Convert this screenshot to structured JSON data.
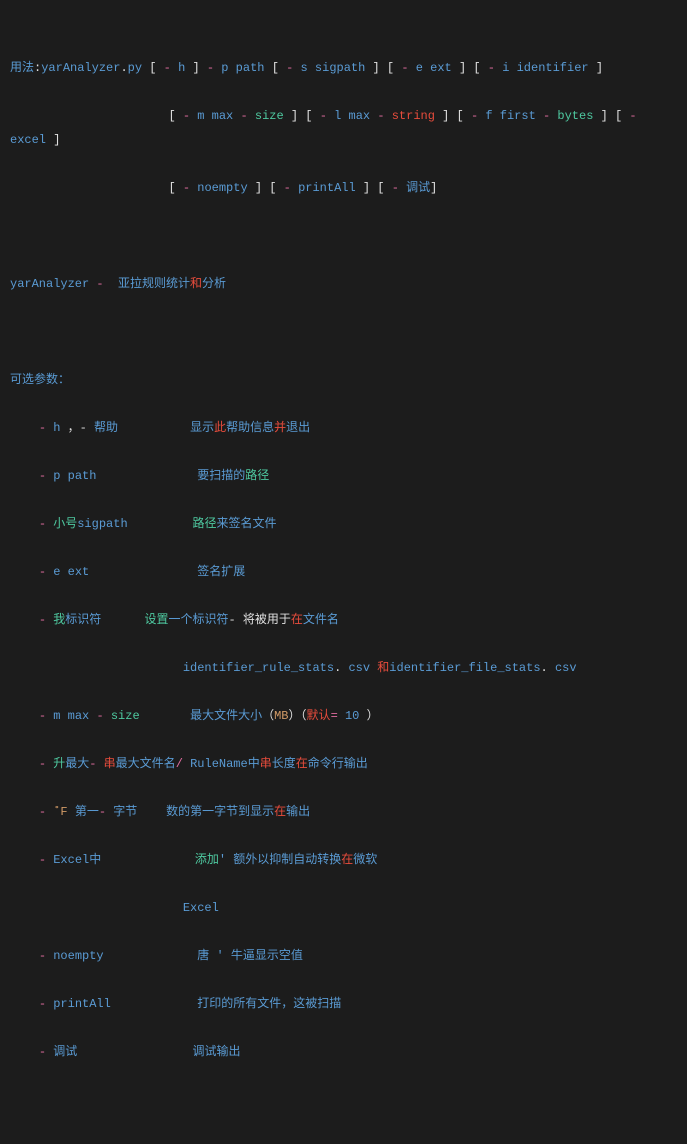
{
  "usage_line1": {
    "t1": "用法",
    "t2": ":",
    "t3": "yarAnalyzer",
    "t4": ".",
    "t5": "py ",
    "t6": "[",
    "t7": " - ",
    "t8": "h ",
    "t9": "]",
    "t10": " - ",
    "t11": "p path ",
    "t12": "[",
    "t13": " - ",
    "t14": "s sigpath ",
    "t15": "]",
    "t16": " [",
    "t17": " - ",
    "t18": "e ext ",
    "t19": "]",
    "t20": " [",
    "t21": " - ",
    "t22": "i identifier ",
    "t23": "]"
  },
  "usage_line2": {
    "t1": "[",
    "t2": " - ",
    "t3": "m max ",
    "t4": "- ",
    "t5": "size ",
    "t6": "]",
    "t7": " [",
    "t8": " - ",
    "t9": "l max ",
    "t10": "- ",
    "t11": "string ",
    "t12": "]",
    "t13": " [",
    "t14": " - ",
    "t15": "f first ",
    "t16": "- ",
    "t17": "bytes ",
    "t18": "]",
    "t19": " [",
    "t20": " - ",
    "t21": "excel ",
    "t22": "]"
  },
  "usage_line3": {
    "t1": "[",
    "t2": " - ",
    "t3": "noempty ",
    "t4": "]",
    "t5": " [",
    "t6": " - ",
    "t7": "printAll ",
    "t8": "]",
    "t9": " [",
    "t10": " - ",
    "t11": "调试",
    "t12": "]"
  },
  "desc": {
    "t1": "yarAnalyzer",
    "t2": " - ",
    "t3": " 亚拉规则统计",
    "t4": "和",
    "t5": "分析"
  },
  "opts_label": "可选参数：",
  "h": {
    "t1": "- ",
    "t2": "h ",
    "t3": "，- ",
    "t4": "帮助",
    "t5": "显示",
    "t6": "此",
    "t7": "帮助信息",
    "t8": "并",
    "t9": "退出"
  },
  "p": {
    "t1": "- ",
    "t2": "p path",
    "t3": "要扫描的",
    "t4": "路径"
  },
  "s": {
    "t1": "- ",
    "t2": "小号",
    "t3": "sigpath",
    "t4": "路径",
    "t5": "来",
    "t6": "签名文件"
  },
  "e": {
    "t1": "- ",
    "t2": "e ext",
    "t3": "签名扩展"
  },
  "i": {
    "t1": "- ",
    "t2": "我",
    "t3": "标识符",
    "t4": "设置",
    "t5": "一个标识符",
    "t6": "- 将被用于",
    "t7": "在",
    "t8": "文件名",
    "sub1": "identifier_rule_stats",
    "sub2": ". ",
    "sub3": "csv ",
    "sub4": "和",
    "sub5": "identifier_file_stats",
    "sub6": ". ",
    "sub7": "csv"
  },
  "m": {
    "t1": "- ",
    "t2": "m max ",
    "t3": "- ",
    "t4": "size",
    "t5": "最大文件大小",
    "t6": "（",
    "t7": "MB",
    "t8": "）",
    "t9": "（",
    "t10": "默认",
    "t11": "= ",
    "t12": "10 ",
    "t13": "）"
  },
  "l": {
    "t1": "- ",
    "t2": "升",
    "t3": "最大",
    "t4": "- ",
    "t5": "串",
    "t6": "最大文件名",
    "t7": "/ ",
    "t8": "RuleName",
    "t9": "中",
    "t10": "串",
    "t11": "长度",
    "t12": "在",
    "t13": "命令行输出"
  },
  "f": {
    "t1": "- ",
    "t2": "˚F ",
    "t3": "第一",
    "t4": "- ",
    "t5": "字节",
    "t6": "数的第一字节到显示",
    "t7": "在",
    "t8": "输出"
  },
  "x": {
    "t1": "- ",
    "t2": "Excel中",
    "t3": "添加",
    "t4": "' 额外以抑制自动转换",
    "t5": "在",
    "t6": "微软",
    "sub1": "Excel"
  },
  "n": {
    "t1": "- ",
    "t2": "noempty",
    "t3": "唐 ",
    "t4": "' 牛逼显示空值"
  },
  "pa": {
    "t1": "- ",
    "t2": "printAll",
    "t3": "打印的所有文件，这被扫描"
  },
  "d": {
    "t1": "- ",
    "t2": "调试",
    "t3": "调试输出"
  }
}
